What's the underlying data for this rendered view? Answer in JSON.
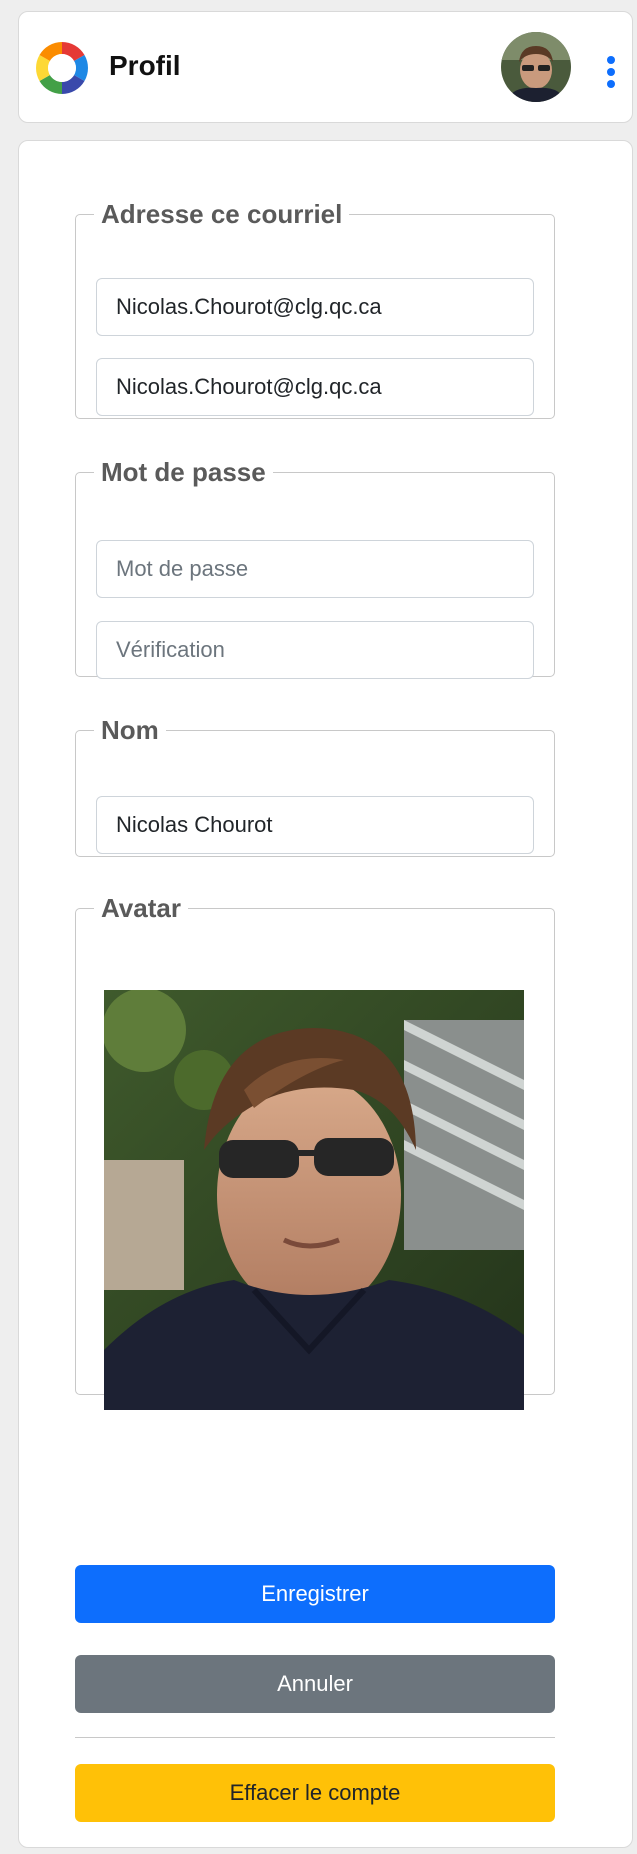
{
  "header": {
    "title": "Profil",
    "logo_icon": "aperture-logo-icon",
    "avatar_icon": "user-avatar-icon",
    "menu_icon": "kebab-menu-icon",
    "accent_color": "#0d6efd"
  },
  "email": {
    "legend": "Adresse ce courriel",
    "value": "Nicolas.Chourot@clg.qc.ca",
    "confirm_value": "Nicolas.Chourot@clg.qc.ca"
  },
  "password": {
    "legend": "Mot de passe",
    "placeholder": "Mot de passe",
    "verify_placeholder": "Vérification"
  },
  "name": {
    "legend": "Nom",
    "value": "Nicolas Chourot"
  },
  "avatar": {
    "legend": "Avatar"
  },
  "actions": {
    "save_label": "Enregistrer",
    "cancel_label": "Annuler",
    "delete_label": "Effacer le compte",
    "colors": {
      "primary": "#0d6efd",
      "secondary": "#6c757d",
      "warning": "#ffc107"
    }
  }
}
